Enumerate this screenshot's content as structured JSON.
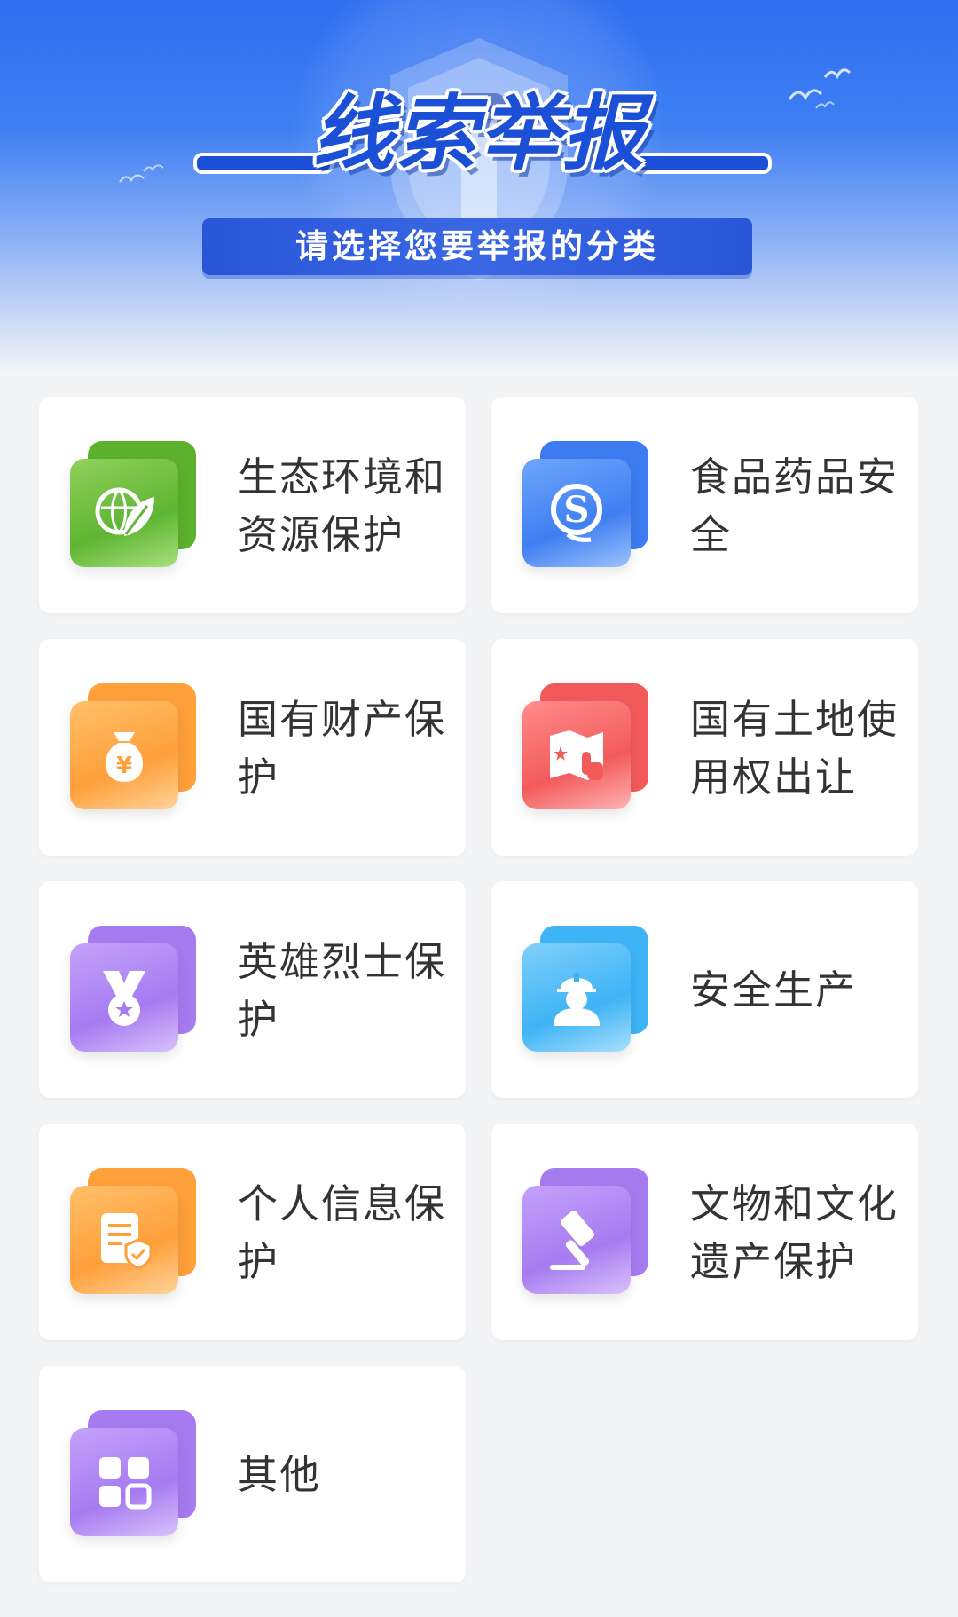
{
  "header": {
    "title": "线索举报",
    "subtitle": "请选择您要举报的分类"
  },
  "categories": [
    {
      "label": "生态环境和资源保护",
      "icon": "globe-leaf-icon",
      "color": "#5db12e"
    },
    {
      "label": "食品药品安全",
      "icon": "qs-safety-mark-icon",
      "color": "#3d7cf0"
    },
    {
      "label": "国有财产保护",
      "icon": "money-bag-icon",
      "color": "#ffa03a"
    },
    {
      "label": "国有土地使用权出让",
      "icon": "land-map-touch-icon",
      "color": "#f25a5a"
    },
    {
      "label": "英雄烈士保护",
      "icon": "medal-icon",
      "color": "#a77bf0"
    },
    {
      "label": "安全生产",
      "icon": "worker-helmet-icon",
      "color": "#3eb4f7"
    },
    {
      "label": "个人信息保护",
      "icon": "document-shield-icon",
      "color": "#ffa03a"
    },
    {
      "label": "文物和文化遗产保护",
      "icon": "gavel-icon",
      "color": "#a77bf0"
    },
    {
      "label": "其他",
      "icon": "grid-apps-icon",
      "color": "#a77bf0"
    }
  ]
}
